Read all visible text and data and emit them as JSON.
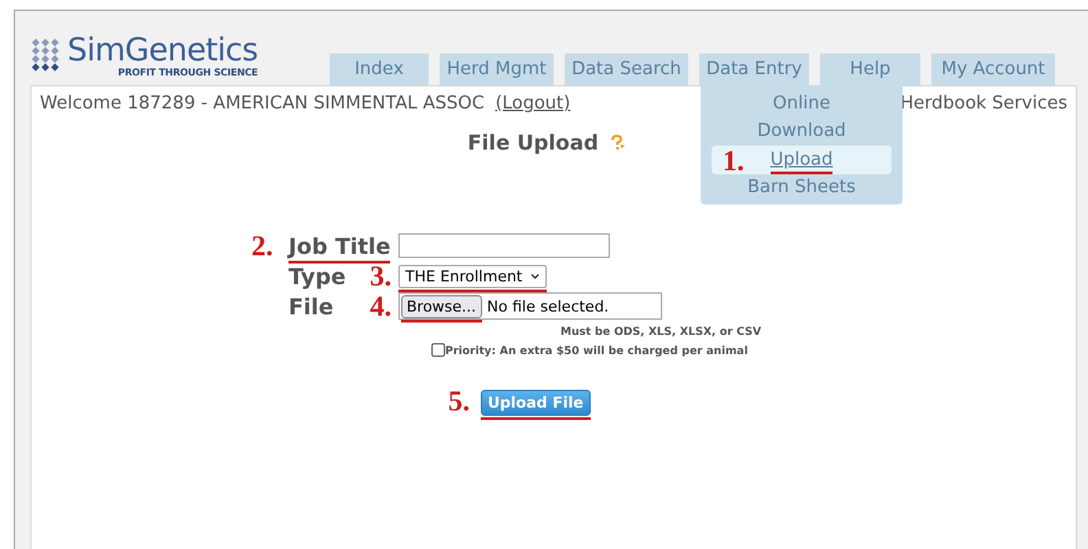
{
  "logo": {
    "name": "SimGenetics",
    "tagline": "PROFIT THROUGH SCIENCE"
  },
  "tabs": [
    {
      "label": "Index"
    },
    {
      "label": "Herd Mgmt"
    },
    {
      "label": "Data Search"
    },
    {
      "label": "Data Entry"
    },
    {
      "label": "Help"
    },
    {
      "label": "My Account"
    }
  ],
  "menu": {
    "items": [
      {
        "label": "Online",
        "selected": false
      },
      {
        "label": "Download",
        "selected": false
      },
      {
        "label": "Upload",
        "selected": true,
        "annotation": "1."
      },
      {
        "label": "Barn Sheets",
        "selected": false
      }
    ]
  },
  "welcome": {
    "text": "Welcome 187289 - AMERICAN SIMMENTAL ASSOC",
    "logout": "(Logout)",
    "right": "Herdbook Services"
  },
  "page_title": "File Upload",
  "form": {
    "job_title": {
      "label": "Job Title",
      "annotation": "2."
    },
    "type": {
      "label": "Type",
      "value": "THE Enrollment",
      "annotation": "3."
    },
    "file": {
      "label": "File",
      "button": "Browse...",
      "status": "No file selected.",
      "annotation": "4."
    },
    "hint": "Must be ODS, XLS, XLSX, or CSV",
    "priority": {
      "label": "Priority: An extra $50 will be charged per animal",
      "checked": false
    },
    "submit": {
      "label": "Upload File",
      "annotation": "5."
    }
  }
}
